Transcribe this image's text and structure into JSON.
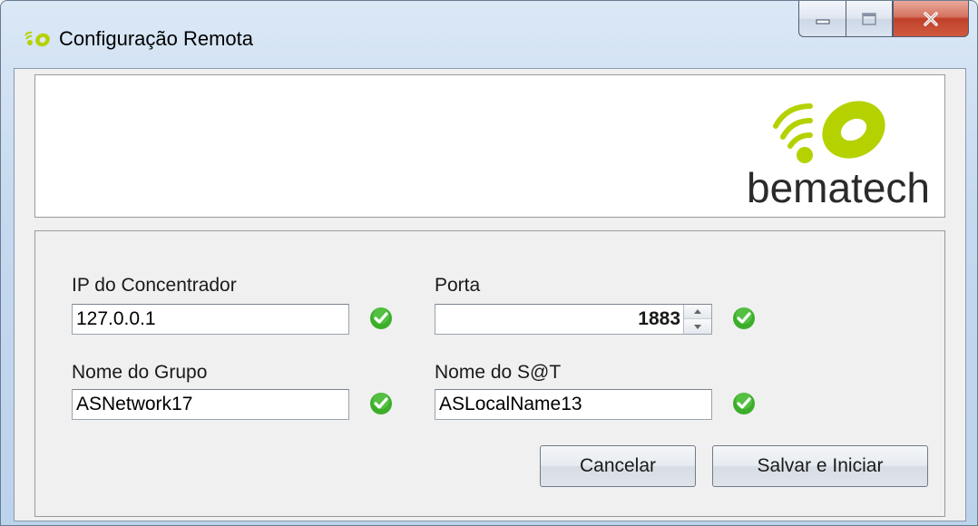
{
  "window": {
    "title": "Configuração Remota",
    "app_icon": "bematech-logo-icon",
    "controls": [
      "minimize-icon",
      "maximize-icon",
      "close-icon"
    ]
  },
  "banner": {
    "logo_text": "bematech",
    "logo_accent_color": "#b5d200",
    "logo_text_color": "#2a2a2a"
  },
  "form": {
    "ip": {
      "label": "IP do Concentrador",
      "value": "127.0.0.1",
      "status": "valid"
    },
    "porta": {
      "label": "Porta",
      "value": "1883",
      "status": "valid"
    },
    "grupo": {
      "label": "Nome do Grupo",
      "value": "ASNetwork17",
      "status": "valid"
    },
    "sat": {
      "label": "Nome do S@T",
      "value": "ASLocalName13",
      "status": "valid"
    }
  },
  "buttons": {
    "cancel_label": "Cancelar",
    "save_label": "Salvar e Iniciar"
  },
  "colors": {
    "valid_check": "#3cae2a",
    "window_frame": "#c5d9ef",
    "close_button": "#c8452e"
  }
}
